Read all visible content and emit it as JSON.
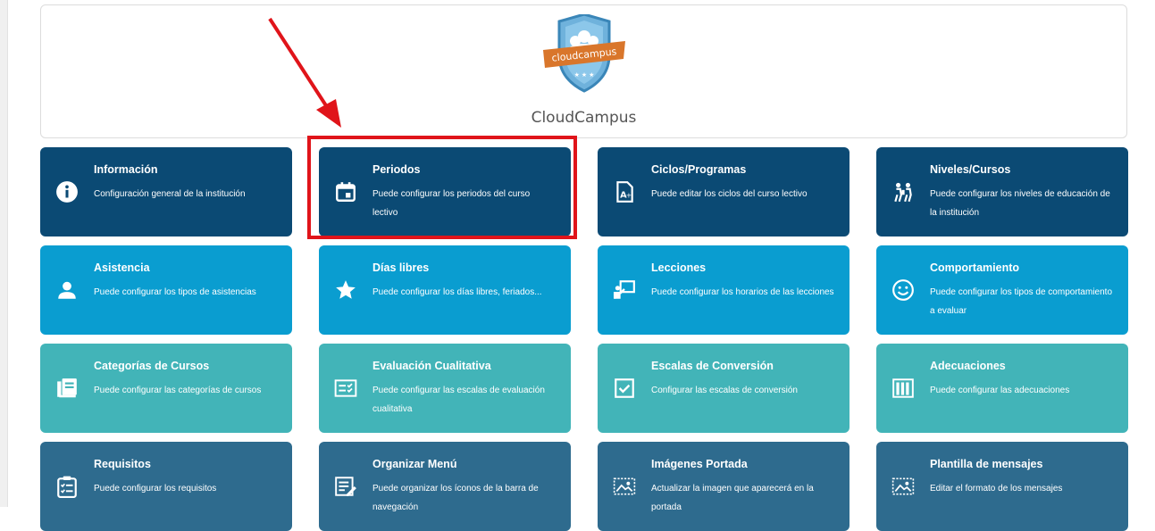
{
  "header": {
    "logo_text": "cloudcampus",
    "school_name": "CloudCampus"
  },
  "annotation": {
    "color": "#e0141a",
    "target": "Periodos"
  },
  "colors": {
    "dark_blue": "#0b4a74",
    "light_blue": "#0a9dd0",
    "teal": "#42b4b8",
    "steel_blue": "#2e6b8e"
  },
  "tiles": [
    {
      "title": "Información",
      "desc": "Configuración general de la institución",
      "icon": "info-icon"
    },
    {
      "title": "Periodos",
      "desc": "Puede configurar los periodos del curso lectivo",
      "icon": "calendar-icon"
    },
    {
      "title": "Ciclos/Programas",
      "desc": "Puede editar los ciclos del curso lectivo",
      "icon": "document-icon"
    },
    {
      "title": "Niveles/Cursos",
      "desc": "Puede configurar los niveles de educación de la institución",
      "icon": "students-icon"
    },
    {
      "title": "Asistencia",
      "desc": "Puede configurar los tipos de asistencias",
      "icon": "person-icon"
    },
    {
      "title": "Días libres",
      "desc": "Puede configurar los días libres, feriados...",
      "icon": "star-icon"
    },
    {
      "title": "Lecciones",
      "desc": "Puede configurar los horarios de las lecciones",
      "icon": "teacher-board-icon"
    },
    {
      "title": "Comportamiento",
      "desc": "Puede configurar los tipos de comportamiento a evaluar",
      "icon": "smiley-icon"
    },
    {
      "title": "Categorías de Cursos",
      "desc": "Puede configurar las categorías de cursos",
      "icon": "library-icon"
    },
    {
      "title": "Evaluación Cualitativa",
      "desc": "Puede configurar las escalas de evaluación cualitativa",
      "icon": "checklist-icon"
    },
    {
      "title": "Escalas de Conversión",
      "desc": "Configurar las escalas de conversión",
      "icon": "checkbox-icon"
    },
    {
      "title": "Adecuaciones",
      "desc": "Puede configurar las adecuaciones",
      "icon": "books-icon"
    },
    {
      "title": "Requisitos",
      "desc": "Puede configurar los requisitos",
      "icon": "clipboard-icon"
    },
    {
      "title": "Organizar Menú",
      "desc": "Puede organizar los íconos de la barra de navegación",
      "icon": "edit-list-icon"
    },
    {
      "title": "Imágenes Portada",
      "desc": "Actualizar la imagen que aparecerá en la portada",
      "icon": "image-icon"
    },
    {
      "title": "Plantilla de mensajes",
      "desc": "Editar el formato de los mensajes",
      "icon": "image-frame-icon"
    }
  ]
}
